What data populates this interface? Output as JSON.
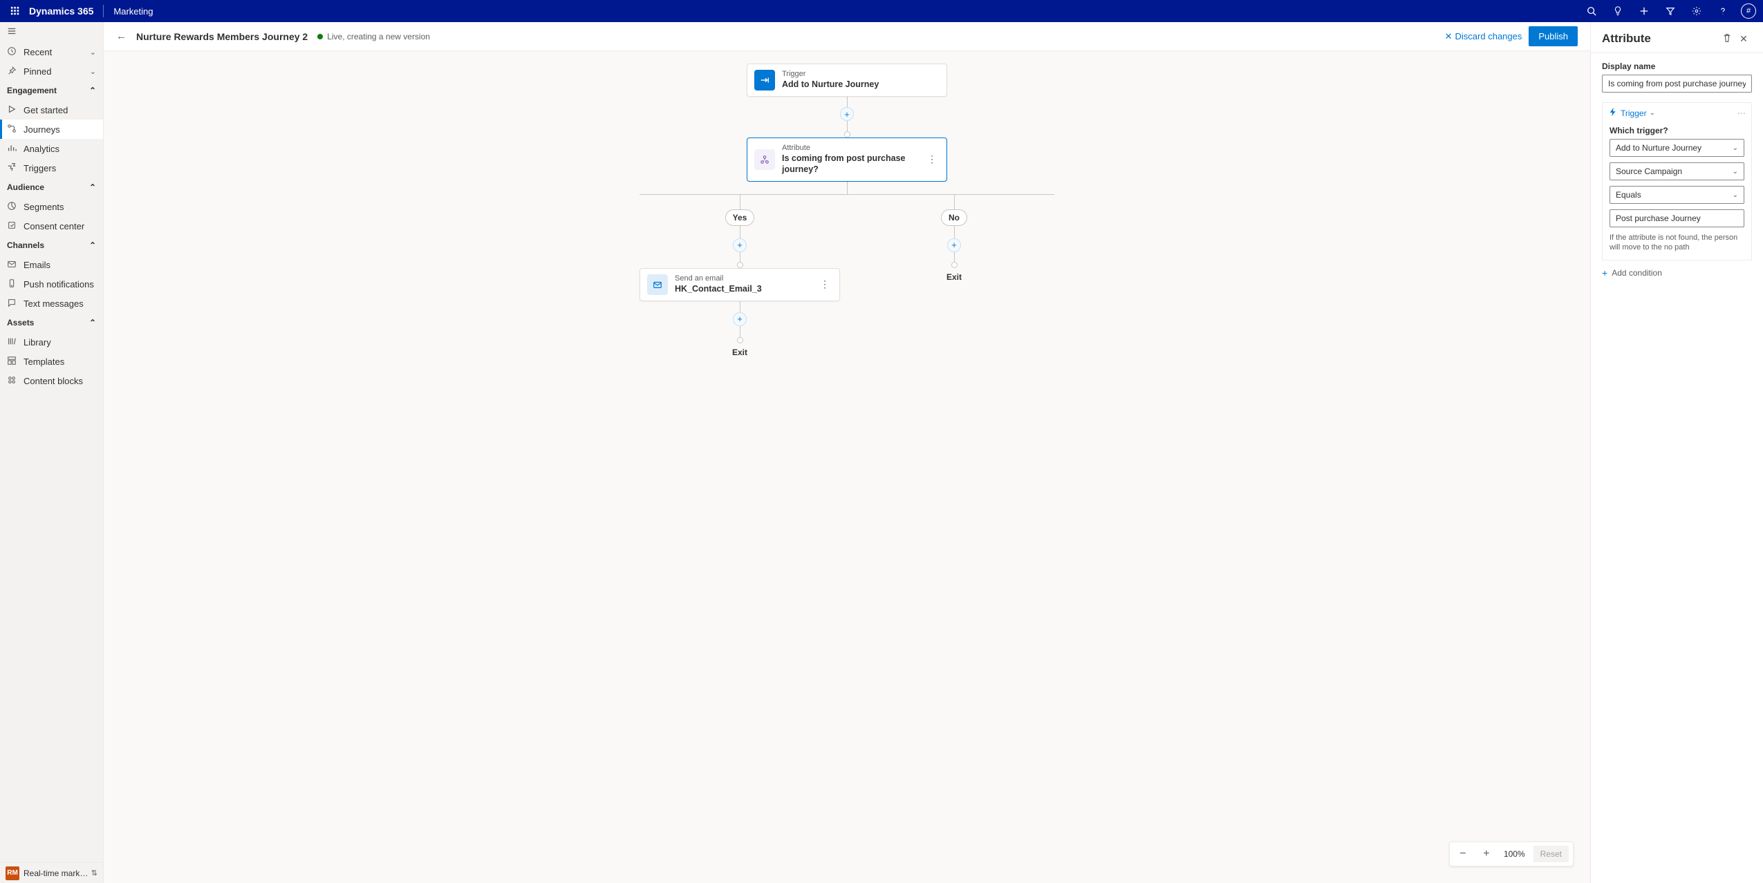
{
  "topbar": {
    "brand": "Dynamics 365",
    "module": "Marketing",
    "avatar": "#"
  },
  "sidebar": {
    "recent": "Recent",
    "pinned": "Pinned",
    "groups": {
      "engagement": "Engagement",
      "audience": "Audience",
      "channels": "Channels",
      "assets": "Assets"
    },
    "items": {
      "get_started": "Get started",
      "journeys": "Journeys",
      "analytics": "Analytics",
      "triggers": "Triggers",
      "segments": "Segments",
      "consent_center": "Consent center",
      "emails": "Emails",
      "push": "Push notifications",
      "text": "Text messages",
      "library": "Library",
      "templates": "Templates",
      "blocks": "Content blocks"
    },
    "footer_badge": "RM",
    "footer_label": "Real-time marketi..."
  },
  "header": {
    "title": "Nurture Rewards Members Journey 2",
    "status": "Live, creating a new version",
    "discard": "Discard changes",
    "publish": "Publish"
  },
  "canvas": {
    "trigger_label": "Trigger",
    "trigger_title": "Add to Nurture Journey",
    "attribute_label": "Attribute",
    "attribute_title": "Is coming from post purchase journey?",
    "yes": "Yes",
    "no": "No",
    "email_label": "Send an email",
    "email_title": "HK_Contact_Email_3",
    "exit": "Exit"
  },
  "zoom": {
    "value": "100%",
    "reset": "Reset"
  },
  "panel": {
    "title": "Attribute",
    "display_name_label": "Display name",
    "display_name_value": "Is coming from post purchase journey?",
    "cond_trigger": "Trigger",
    "which_trigger_label": "Which trigger?",
    "dd_trigger": "Add to Nurture Journey",
    "dd_field": "Source Campaign",
    "dd_op": "Equals",
    "dd_value": "Post purchase Journey",
    "help": "If the attribute is not found, the person will move to the no path",
    "add_condition": "Add condition"
  }
}
